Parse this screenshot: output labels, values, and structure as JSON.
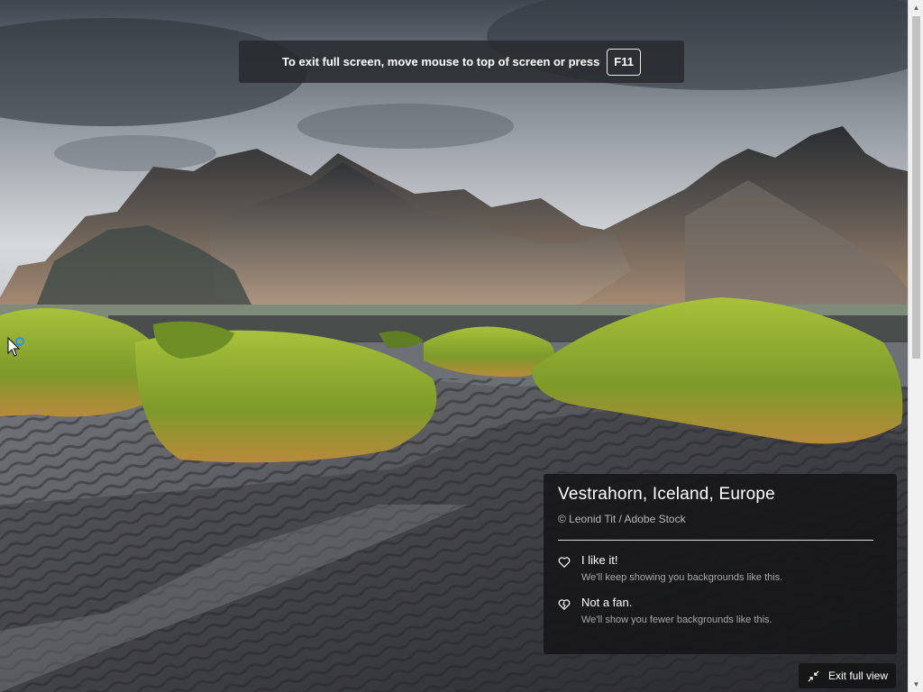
{
  "fullscreen_notice": {
    "message": "To exit full screen, move mouse to top of screen or press",
    "key": "F11"
  },
  "background": {
    "title": "Vestrahorn, Iceland, Europe",
    "credit": "© Leonid Tit / Adobe Stock"
  },
  "feedback": {
    "like": {
      "label": "I like it!",
      "description": "We'll keep showing you backgrounds like this.",
      "icon": "heart-icon"
    },
    "dislike": {
      "label": "Not a fan.",
      "description": "We'll show you fewer backgrounds like this.",
      "icon": "broken-heart-icon"
    }
  },
  "exit_button": {
    "label": "Exit full view",
    "icon": "collapse-arrows-icon"
  },
  "colors": {
    "overlay": "#161618",
    "text": "#ffffff",
    "muted_text": "#b8b8b8",
    "scrollbar": "#f0f0f0"
  }
}
